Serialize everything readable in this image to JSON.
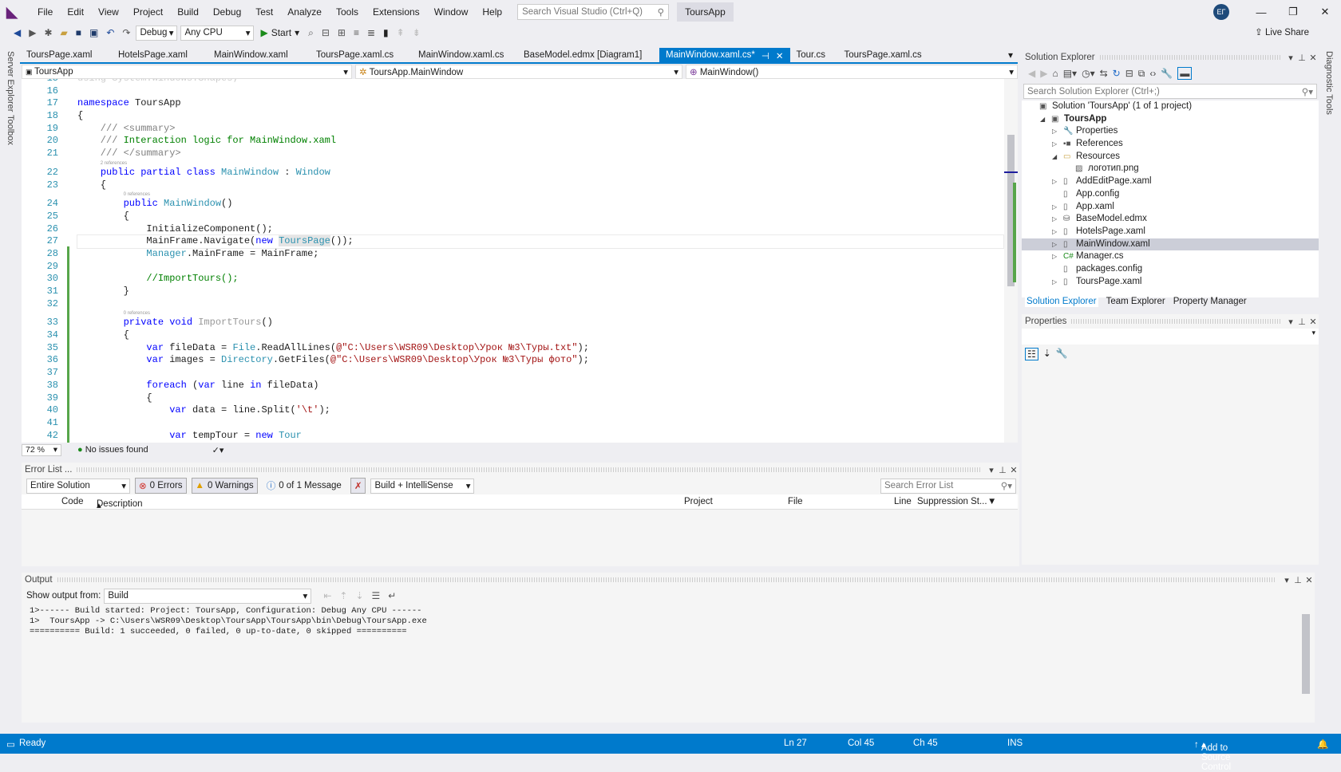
{
  "menubar": {
    "items": [
      "File",
      "Edit",
      "View",
      "Project",
      "Build",
      "Debug",
      "Test",
      "Analyze",
      "Tools",
      "Extensions",
      "Window",
      "Help"
    ],
    "search_placeholder": "Search Visual Studio (Ctrl+Q)",
    "app_title": "ToursApp",
    "avatar": "EГ"
  },
  "toolbar": {
    "config": "Debug",
    "platform": "Any CPU",
    "start": "Start",
    "live_share": "Live Share"
  },
  "side": {
    "left": [
      "Server Explorer",
      "Toolbox"
    ],
    "right": "Diagnostic Tools"
  },
  "tabs": [
    {
      "label": "ToursPage.xaml"
    },
    {
      "label": "HotelsPage.xaml"
    },
    {
      "label": "MainWindow.xaml"
    },
    {
      "label": "ToursPage.xaml.cs"
    },
    {
      "label": "MainWindow.xaml.cs"
    },
    {
      "label": "BaseModel.edmx [Diagram1]"
    },
    {
      "label": "MainWindow.xaml.cs*",
      "active": true
    },
    {
      "label": "Tour.cs"
    },
    {
      "label": "ToursPage.xaml.cs"
    }
  ],
  "navbar": {
    "project": "ToursApp",
    "type": "ToursApp.MainWindow",
    "member": "MainWindow()"
  },
  "editor": {
    "lines": [
      {
        "n": "15",
        "tokens": [
          [
            "using System.Windows.Shapes;",
            "gr"
          ]
        ]
      },
      {
        "n": "16",
        "tokens": []
      },
      {
        "n": "17",
        "tokens": [
          [
            "namespace",
            "kw"
          ],
          [
            " ToursApp",
            ""
          ]
        ]
      },
      {
        "n": "18",
        "tokens": [
          [
            "{",
            ""
          ]
        ]
      },
      {
        "n": "19",
        "tokens": [
          [
            "    /// <summary>",
            "dc"
          ]
        ]
      },
      {
        "n": "20",
        "tokens": [
          [
            "    /// ",
            "dc"
          ],
          [
            "Interaction logic for MainWindow.xaml",
            "cm"
          ]
        ]
      },
      {
        "n": "21",
        "tokens": [
          [
            "    /// </summary>",
            "dc"
          ]
        ],
        "lens_after": "2 references"
      },
      {
        "n": "22",
        "tokens": [
          [
            "    ",
            ""
          ],
          [
            "public partial class",
            "kw"
          ],
          [
            " ",
            ""
          ],
          [
            "MainWindow",
            "ty"
          ],
          [
            " : ",
            ""
          ],
          [
            "Window",
            "ty"
          ]
        ]
      },
      {
        "n": "23",
        "tokens": [
          [
            "    {",
            ""
          ]
        ],
        "lens_after": "0 references"
      },
      {
        "n": "24",
        "tokens": [
          [
            "        ",
            ""
          ],
          [
            "public",
            "kw"
          ],
          [
            " ",
            ""
          ],
          [
            "MainWindow",
            "ty"
          ],
          [
            "()",
            ""
          ]
        ]
      },
      {
        "n": "25",
        "tokens": [
          [
            "        {",
            ""
          ]
        ]
      },
      {
        "n": "26",
        "tokens": [
          [
            "            InitializeComponent();",
            ""
          ]
        ]
      },
      {
        "n": "27",
        "tokens": [
          [
            "            MainFrame.Navigate(",
            ""
          ],
          [
            "new",
            "kw"
          ],
          [
            " ",
            ""
          ],
          [
            "ToursPage",
            "ty hl"
          ],
          [
            "());",
            ""
          ]
        ],
        "current": true
      },
      {
        "n": "28",
        "tokens": [
          [
            "            ",
            ""
          ],
          [
            "Manager",
            "ty"
          ],
          [
            ".MainFrame = MainFrame;",
            ""
          ]
        ]
      },
      {
        "n": "29",
        "tokens": []
      },
      {
        "n": "30",
        "tokens": [
          [
            "            //ImportTours();",
            "cm"
          ]
        ]
      },
      {
        "n": "31",
        "tokens": [
          [
            "        }",
            ""
          ]
        ]
      },
      {
        "n": "32",
        "tokens": [],
        "lens_after": "0 references"
      },
      {
        "n": "33",
        "tokens": [
          [
            "        ",
            ""
          ],
          [
            "private void",
            "kw"
          ],
          [
            " ",
            ""
          ],
          [
            "ImportTours",
            "gr"
          ],
          [
            "()",
            ""
          ]
        ]
      },
      {
        "n": "34",
        "tokens": [
          [
            "        {",
            ""
          ]
        ]
      },
      {
        "n": "35",
        "tokens": [
          [
            "            ",
            ""
          ],
          [
            "var",
            "kw"
          ],
          [
            " fileData = ",
            ""
          ],
          [
            "File",
            "ty"
          ],
          [
            ".ReadAllLines(",
            ""
          ],
          [
            "@\"C:\\Users\\WSR09\\Desktop\\Урок №3\\Туры.txt\"",
            "st"
          ],
          [
            ");",
            ""
          ]
        ]
      },
      {
        "n": "36",
        "tokens": [
          [
            "            ",
            ""
          ],
          [
            "var",
            "kw"
          ],
          [
            " images = ",
            ""
          ],
          [
            "Directory",
            "ty"
          ],
          [
            ".GetFiles(",
            ""
          ],
          [
            "@\"C:\\Users\\WSR09\\Desktop\\Урок №3\\Туры фото\"",
            "st"
          ],
          [
            ");",
            ""
          ]
        ]
      },
      {
        "n": "37",
        "tokens": []
      },
      {
        "n": "38",
        "tokens": [
          [
            "            ",
            ""
          ],
          [
            "foreach",
            "kw"
          ],
          [
            " (",
            ""
          ],
          [
            "var",
            "kw"
          ],
          [
            " line ",
            ""
          ],
          [
            "in",
            "kw"
          ],
          [
            " fileData)",
            ""
          ]
        ]
      },
      {
        "n": "39",
        "tokens": [
          [
            "            {",
            ""
          ]
        ]
      },
      {
        "n": "40",
        "tokens": [
          [
            "                ",
            ""
          ],
          [
            "var",
            "kw"
          ],
          [
            " data = line.Split(",
            ""
          ],
          [
            "'\\t'",
            "st"
          ],
          [
            ");",
            ""
          ]
        ]
      },
      {
        "n": "41",
        "tokens": []
      },
      {
        "n": "42",
        "tokens": [
          [
            "                ",
            ""
          ],
          [
            "var",
            "kw"
          ],
          [
            " tempTour = ",
            ""
          ],
          [
            "new",
            "kw"
          ],
          [
            " ",
            ""
          ],
          [
            "Tour",
            "ty"
          ]
        ]
      }
    ]
  },
  "editor_status": {
    "zoom": "72 %",
    "issues": "No issues found"
  },
  "error_list": {
    "title": "Error List ...",
    "scope": "Entire Solution",
    "errors": "0 Errors",
    "warnings": "0 Warnings",
    "messages": "0 of 1 Message",
    "source": "Build + IntelliSense",
    "search_placeholder": "Search Error List",
    "columns": [
      "Code",
      "Description",
      "Project",
      "File",
      "Line",
      "Suppression St..."
    ]
  },
  "output": {
    "title": "Output",
    "show_from_label": "Show output from:",
    "show_from": "Build",
    "lines": [
      "1>------ Build started: Project: ToursApp, Configuration: Debug Any CPU ------",
      "1>  ToursApp -> C:\\Users\\WSR09\\Desktop\\ToursApp\\ToursApp\\bin\\Debug\\ToursApp.exe",
      "========== Build: 1 succeeded, 0 failed, 0 up-to-date, 0 skipped =========="
    ]
  },
  "solution_explorer": {
    "title": "Solution Explorer",
    "search_placeholder": "Search Solution Explorer (Ctrl+;)",
    "items": [
      {
        "label": "Solution 'ToursApp' (1 of 1 project)",
        "level": 0,
        "icon": "solution-icon"
      },
      {
        "label": "ToursApp",
        "level": 1,
        "icon": "csharp-project-icon",
        "expanded": true,
        "bold": true
      },
      {
        "label": "Properties",
        "level": 2,
        "icon": "wrench-icon",
        "collapsed": true
      },
      {
        "label": "References",
        "level": 2,
        "icon": "references-icon",
        "collapsed": true
      },
      {
        "label": "Resources",
        "level": 2,
        "icon": "folder-icon",
        "expanded": true
      },
      {
        "label": "логотип.png",
        "level": 3,
        "icon": "image-icon"
      },
      {
        "label": "AddEditPage.xaml",
        "level": 2,
        "icon": "xaml-file-icon",
        "collapsed": true
      },
      {
        "label": "App.config",
        "level": 2,
        "icon": "config-file-icon"
      },
      {
        "label": "App.xaml",
        "level": 2,
        "icon": "xaml-file-icon",
        "collapsed": true
      },
      {
        "label": "BaseModel.edmx",
        "level": 2,
        "icon": "edmx-file-icon",
        "collapsed": true
      },
      {
        "label": "HotelsPage.xaml",
        "level": 2,
        "icon": "xaml-file-icon",
        "collapsed": true
      },
      {
        "label": "MainWindow.xaml",
        "level": 2,
        "icon": "xaml-file-icon",
        "collapsed": true,
        "selected": true
      },
      {
        "label": "Manager.cs",
        "level": 2,
        "icon": "csharp-file-icon",
        "collapsed": true
      },
      {
        "label": "packages.config",
        "level": 2,
        "icon": "config-file-icon"
      },
      {
        "label": "ToursPage.xaml",
        "level": 2,
        "icon": "xaml-file-icon",
        "collapsed": true
      }
    ],
    "bottom_tabs": [
      "Solution Explorer",
      "Team Explorer",
      "Property Manager"
    ]
  },
  "properties": {
    "title": "Properties"
  },
  "statusbar": {
    "ready": "Ready",
    "ln": "Ln 27",
    "col": "Col 45",
    "ch": "Ch 45",
    "ins": "INS",
    "source_control": "Add to Source Control"
  },
  "colors": {
    "accent": "#007acc",
    "keyword": "#0000ff",
    "type": "#2b91af",
    "comment": "#008000",
    "string": "#a31515"
  }
}
